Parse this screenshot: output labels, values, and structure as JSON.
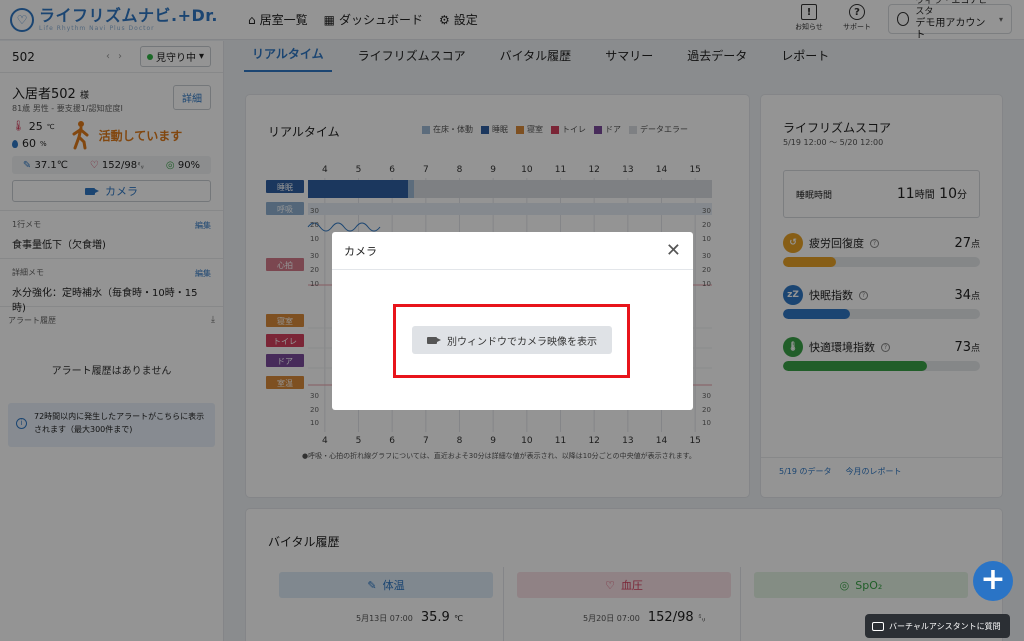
{
  "app": {
    "logo_title": "ライフリズムナビ.+Dr.",
    "logo_sub": "Life Rhythm Navi Plus Doctor"
  },
  "topnav": [
    {
      "label": "居室一覧",
      "icon": "home-icon"
    },
    {
      "label": "ダッシュボード",
      "icon": "grid-icon"
    },
    {
      "label": "設定",
      "icon": "gear-icon"
    }
  ],
  "header_right": {
    "notice": "お知らせ",
    "support": "サポート",
    "account_org": "ヴィラ・エコナビスタ",
    "account_name": "デモ用アカウント"
  },
  "sidebar": {
    "room": "502",
    "watch_status": "見守り中",
    "resident_name": "入居者502",
    "resident_honorific": "様",
    "resident_info": "81歳 男性 - 要支援1/認知症度I",
    "detail_label": "詳細",
    "room_temp": "25",
    "room_temp_unit": "℃",
    "humidity": "60",
    "humidity_unit": "%",
    "activity": "活動しています",
    "body_temp": "37.1℃",
    "blood_pressure": "152/98",
    "blood_pressure_unit": "㍉",
    "spo2": "90%",
    "camera_label": "カメラ",
    "memo1_label": "1行メモ",
    "memo1_edit": "編集",
    "memo1_text": "食事量低下（欠食増)",
    "memo2_label": "詳細メモ",
    "memo2_edit": "編集",
    "memo2_text": "水分強化：定時補水（毎食時・10時・15時)",
    "alert_label": "アラート履歴",
    "alert_empty": "アラート履歴はありません",
    "alert_info": "72時間以内に発生したアラートがこちらに表示されます（最大300件まで)"
  },
  "tabs": [
    "リアルタイム",
    "ライフリズムスコア",
    "バイタル履歴",
    "サマリー",
    "過去データ",
    "レポート"
  ],
  "active_tab": "リアルタイム",
  "realtime": {
    "title": "リアルタイム",
    "legend": [
      {
        "label": "在床・体動",
        "color": "#9fbbd6"
      },
      {
        "label": "睡眠",
        "color": "#2f5fa3"
      },
      {
        "label": "寝室",
        "color": "#d98a3a"
      },
      {
        "label": "トイレ",
        "color": "#d4405e"
      },
      {
        "label": "ドア",
        "color": "#7a4b9c"
      },
      {
        "label": "データエラー",
        "color": "#d9dde2"
      }
    ],
    "hours": [
      "4",
      "5",
      "6",
      "7",
      "8",
      "9",
      "10",
      "11",
      "12",
      "13",
      "14",
      "15"
    ],
    "rows": [
      {
        "label": "睡眠",
        "color": "#2f5fa3"
      },
      {
        "label": "呼吸",
        "color": "#8fb0d0"
      },
      {
        "label": "心拍",
        "color": "#d47a8a"
      },
      {
        "label": "寝室",
        "color": "#d98a3a"
      },
      {
        "label": "トイレ",
        "color": "#d4405e"
      },
      {
        "label": "ドア",
        "color": "#7a4b9c"
      },
      {
        "label": "室温",
        "color": "#d98a3a"
      }
    ],
    "scale_labels": [
      "30",
      "20",
      "10",
      "30",
      "20",
      "10",
      "30",
      "20",
      "10"
    ],
    "note": "●呼吸・心拍の折れ線グラフについては、直近およそ30分は詳細な値が表示され、以降は10分ごとの中央値が表示されます。"
  },
  "score": {
    "title": "ライフリズムスコア",
    "date_range": "5/19 12:00 〜 5/20 12:00",
    "sleep_label": "睡眠時間",
    "sleep_hours": "11",
    "sleep_hours_unit": "時間",
    "sleep_minutes": "10",
    "sleep_minutes_unit": "分",
    "metrics": [
      {
        "label": "疲労回復度",
        "value": "27",
        "unit": "点",
        "fill": 0.27,
        "color": "#e8a326",
        "icon": "fatigue-icon"
      },
      {
        "label": "快眠指数",
        "value": "34",
        "unit": "点",
        "fill": 0.34,
        "color": "#2f78c4",
        "icon": "sleep-zz-icon"
      },
      {
        "label": "快適環境指数",
        "value": "73",
        "unit": "点",
        "fill": 0.73,
        "color": "#3aa348",
        "icon": "thermometer-icon"
      }
    ],
    "footer_links": [
      "5/19 のデータ",
      "今月のレポート"
    ]
  },
  "vitals": {
    "title": "バイタル履歴",
    "columns": [
      {
        "label": "体温",
        "bg": "#dcebf7",
        "color": "#2f78c4",
        "date": "5月13日 07:00",
        "value": "35.9",
        "unit": "℃"
      },
      {
        "label": "血圧",
        "bg": "#f9e0e6",
        "color": "#d4405e",
        "date": "5月20日 07:00",
        "value": "152/98",
        "unit": "㍉"
      },
      {
        "label": "SpO₂",
        "bg": "#e3f3e3",
        "color": "#3aa348",
        "date": "",
        "value": "",
        "unit": ""
      }
    ]
  },
  "modal": {
    "title": "カメラ",
    "button_label": "別ウィンドウでカメラ映像を表示"
  },
  "assistant_label": "バーチャルアシスタントに質問"
}
